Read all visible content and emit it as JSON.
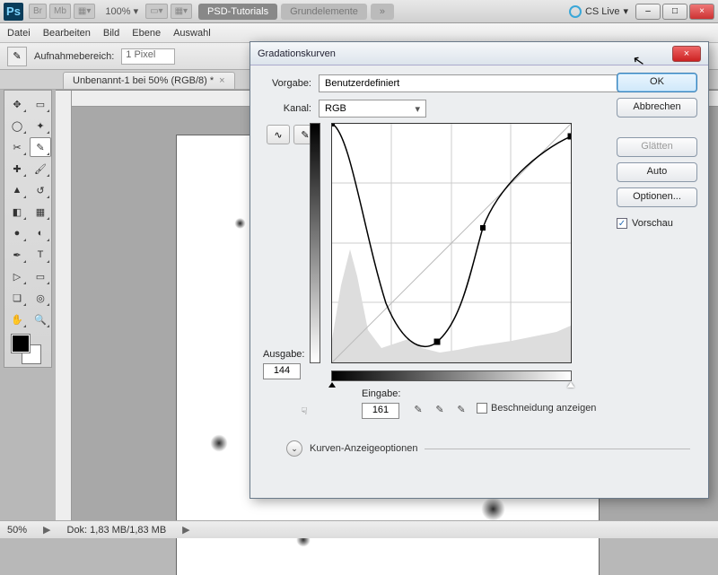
{
  "titlebar": {
    "chips": [
      "Br",
      "Mb"
    ],
    "zoom": "100%",
    "tabs": [
      "PSD-Tutorials",
      "Grundelemente"
    ],
    "more": "»",
    "cslive": "CS Live",
    "min": "–",
    "max": "□",
    "close": "×"
  },
  "menubar": [
    "Datei",
    "Bearbeiten",
    "Bild",
    "Ebene",
    "Auswahl"
  ],
  "optbar": {
    "label": "Aufnahmebereich:",
    "value": "1 Pixel"
  },
  "doctab": {
    "title": "Unbenannt-1 bei 50% (RGB/8) *",
    "x": "×"
  },
  "status": {
    "zoom": "50%",
    "doc": "Dok: 1,83 MB/1,83 MB"
  },
  "dialog": {
    "title": "Gradationskurven",
    "close": "×",
    "preset_lbl": "Vorgabe:",
    "preset_val": "Benutzerdefiniert",
    "kanal_lbl": "Kanal:",
    "kanal_val": "RGB",
    "ausgabe_lbl": "Ausgabe:",
    "ausgabe_val": "144",
    "eingabe_lbl": "Eingabe:",
    "eingabe_val": "161",
    "clip_lbl": "Beschneidung anzeigen",
    "expand_lbl": "Kurven-Anzeigeoptionen",
    "ok": "OK",
    "cancel": "Abbrechen",
    "smooth": "Glätten",
    "auto": "Auto",
    "options": "Optionen...",
    "preview": "Vorschau"
  },
  "chart_data": {
    "type": "line",
    "title": "Gradationskurve (Curves)",
    "xlabel": "Eingabe",
    "ylabel": "Ausgabe",
    "xlim": [
      0,
      255
    ],
    "ylim": [
      0,
      255
    ],
    "control_points": [
      {
        "x": 0,
        "y": 255
      },
      {
        "x": 112,
        "y": 22
      },
      {
        "x": 161,
        "y": 144
      },
      {
        "x": 255,
        "y": 242
      }
    ],
    "selected_point": {
      "x": 161,
      "y": 144
    }
  }
}
